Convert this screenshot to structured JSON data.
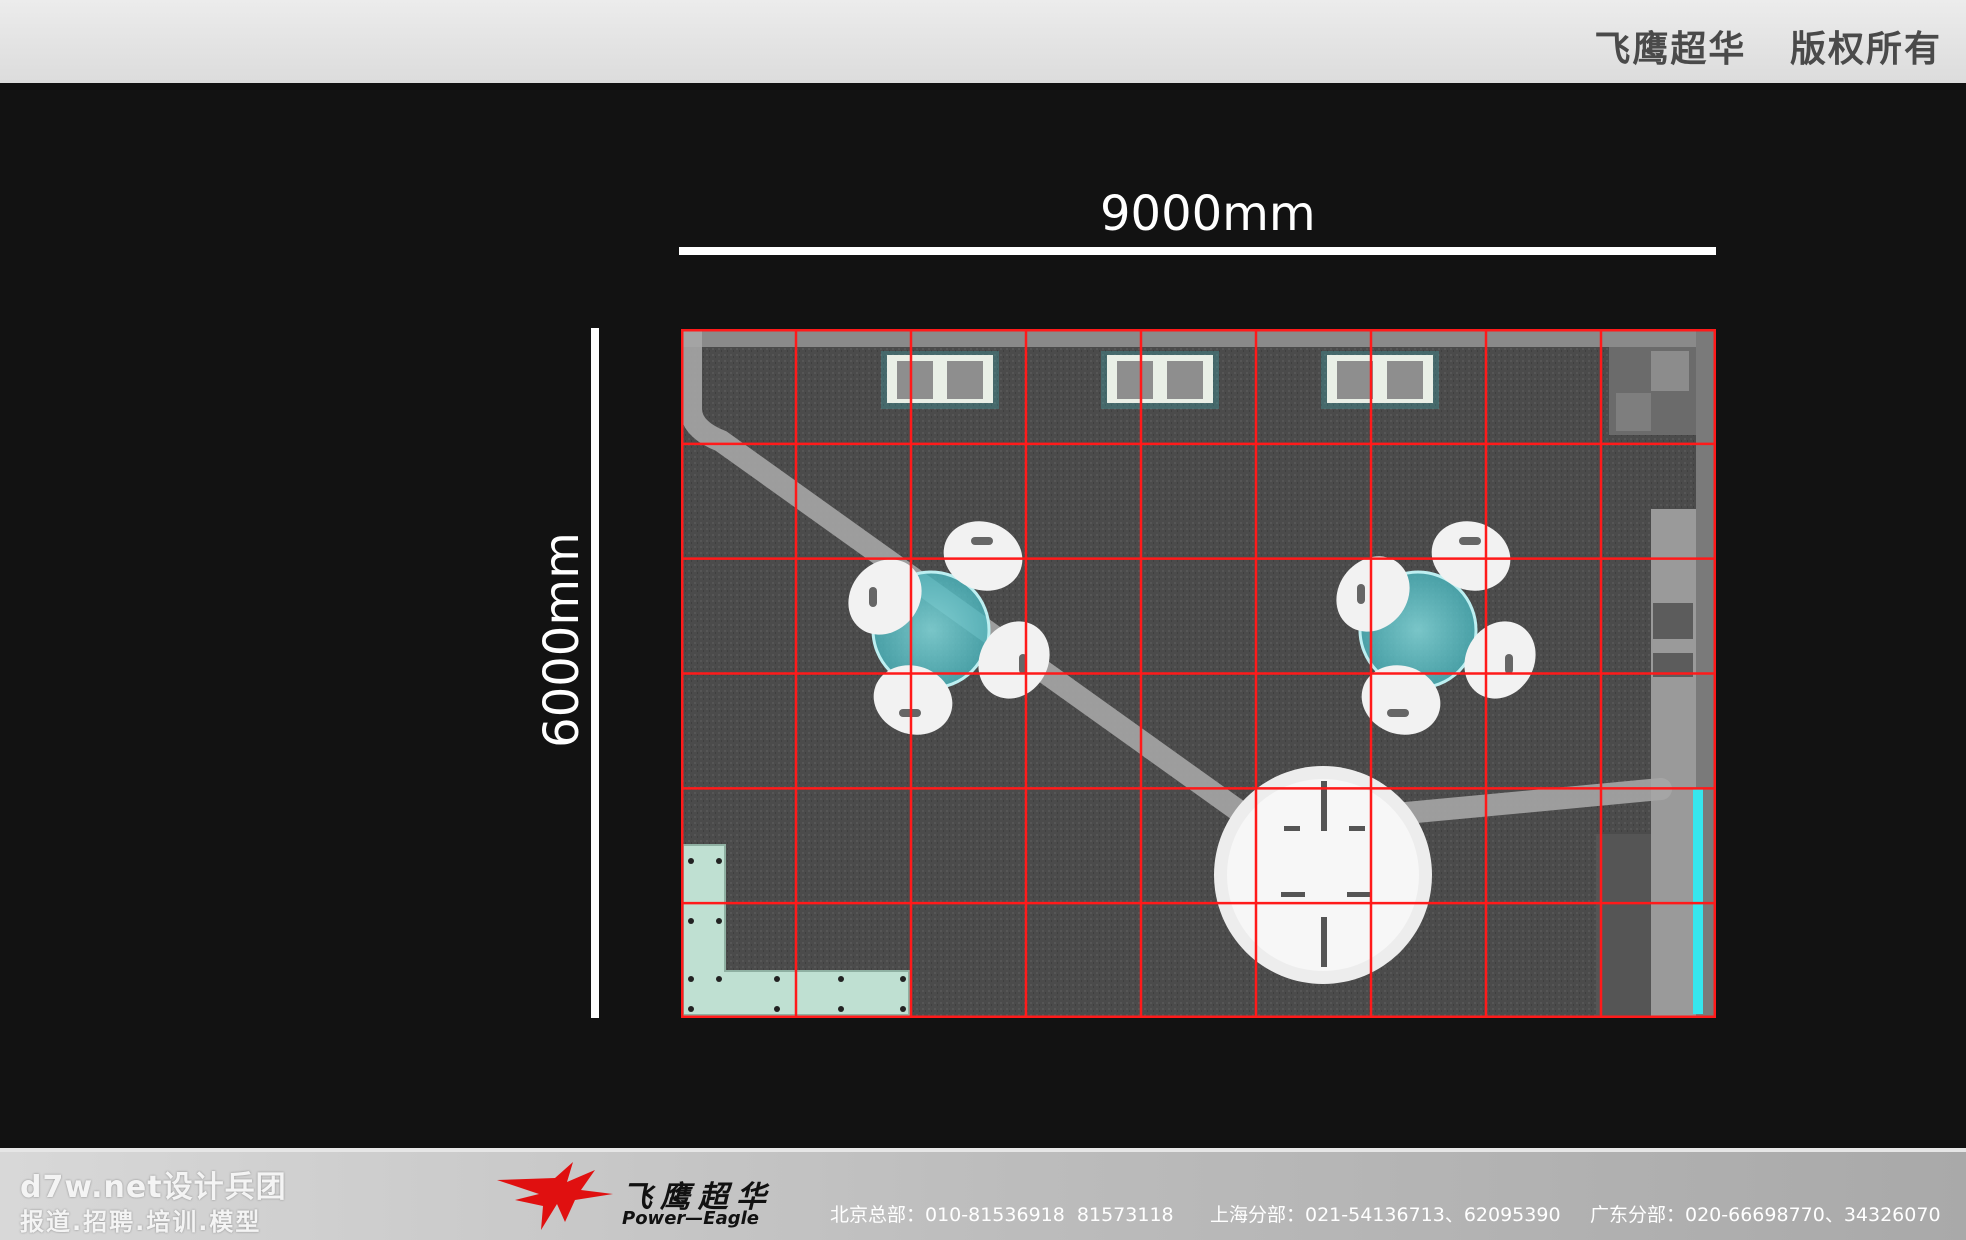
{
  "header": {
    "copyright": "飞鹰超华   版权所有"
  },
  "dimensions": {
    "width_label": "9000mm",
    "height_label": "6000mm"
  },
  "footer": {
    "watermark_line1": "d7w.net设计兵团",
    "watermark_line2": "报道.招聘.培训.模型",
    "logo_cn": "飞鹰超华",
    "logo_en": "Power—Eagle",
    "contacts": [
      "北京总部：010-81536918  81573118",
      "上海分部：021-54136713、62095390",
      "广东分部：020-66698770、34326070"
    ]
  },
  "colors": {
    "grid_line": "#ff1a1a",
    "floor": "#4a4a4a",
    "counter": "#bfe0d2",
    "accent_glow": "#35e6ee"
  },
  "grid": {
    "columns": 9,
    "rows": 6
  }
}
